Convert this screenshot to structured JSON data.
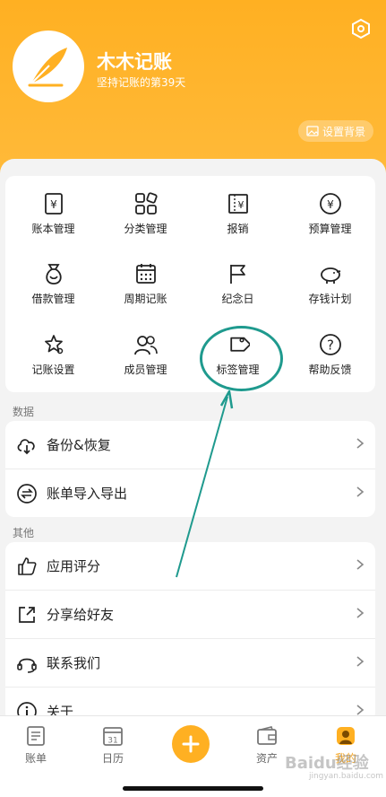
{
  "profile": {
    "title": "木木记账",
    "subtitle": "坚持记账的第39天",
    "set_bg_label": "设置背景"
  },
  "grid": [
    {
      "label": "账本管理",
      "icon": "ledger-icon"
    },
    {
      "label": "分类管理",
      "icon": "category-icon"
    },
    {
      "label": "报销",
      "icon": "reimburse-icon"
    },
    {
      "label": "预算管理",
      "icon": "budget-icon"
    },
    {
      "label": "借款管理",
      "icon": "loan-bag-icon"
    },
    {
      "label": "周期记账",
      "icon": "calendar-grid-icon"
    },
    {
      "label": "纪念日",
      "icon": "flag-icon"
    },
    {
      "label": "存钱计划",
      "icon": "piggy-bank-icon"
    },
    {
      "label": "记账设置",
      "icon": "star-settings-icon"
    },
    {
      "label": "成员管理",
      "icon": "members-icon"
    },
    {
      "label": "标签管理",
      "icon": "tag-icon"
    },
    {
      "label": "帮助反馈",
      "icon": "help-icon"
    }
  ],
  "sections": {
    "data_label": "数据",
    "data_items": [
      {
        "label": "备份&恢复",
        "icon": "cloud-sync-icon"
      },
      {
        "label": "账单导入导出",
        "icon": "import-export-icon"
      }
    ],
    "other_label": "其他",
    "other_items": [
      {
        "label": "应用评分",
        "icon": "thumbs-up-icon"
      },
      {
        "label": "分享给好友",
        "icon": "share-icon"
      },
      {
        "label": "联系我们",
        "icon": "headset-icon"
      },
      {
        "label": "关于",
        "icon": "info-icon"
      }
    ]
  },
  "tabs": [
    {
      "label": "账单",
      "icon": "bill-icon"
    },
    {
      "label": "日历",
      "icon": "calendar-icon",
      "day": "31"
    },
    {
      "label": "资产",
      "icon": "wallet-icon"
    },
    {
      "label": "我的",
      "icon": "user-icon",
      "active": true
    }
  ],
  "watermark": {
    "main": "Baidu经验",
    "sub": "jingyan.baidu.com"
  },
  "colors": {
    "brand": "#ffb022",
    "annotation": "#1f9a8e"
  }
}
